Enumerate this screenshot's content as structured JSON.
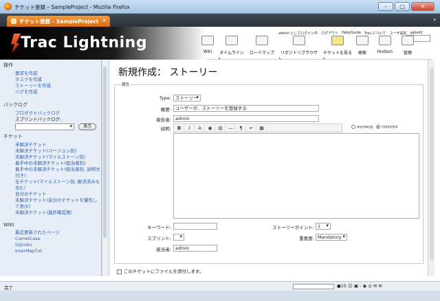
{
  "window": {
    "title": "チケット登録 – SampleProject - Mozilla Firefox",
    "buttons": [
      "–",
      "□",
      "✕"
    ]
  },
  "tab": {
    "label": "チケット登録 – SampleProject",
    "close": "×",
    "menu": "▾"
  },
  "banner": {
    "logo_text": "Trac Lightning",
    "metanav": [
      "admin としてログイン中",
      "ログアウト",
      "Help/Guide",
      "Trac について",
      "ユーザ設定",
      "agile42"
    ],
    "mainnav": [
      "Wiki",
      "タイムライン",
      "ロードマップ",
      "リポジトリブラウザ",
      "チケットを見る",
      "検索",
      "Hudson",
      "管理"
    ]
  },
  "sidebar": {
    "ops_heading": "操作",
    "ops_links": [
      "要求を作成",
      "タスクを作成",
      "ストーリーを作成",
      "バグを作成"
    ],
    "backlog_heading": "バックログ",
    "backlog_links": [
      "プロダクトバックログ"
    ],
    "sprint_backlog_label": "スプリントバックログ:",
    "show_button": "表示",
    "tickets_heading": "チケット",
    "ticket_links": [
      "未解決チケット",
      "未解決チケット(バージョン別)",
      "未解決チケット(マイルストーン別)",
      "着手中の未解決チケット(担当者別)",
      "着手中の未解決チケット(担当者別, 説明文付き)",
      "全チケット(マイルストーン別, 解決済みも含む)",
      "自分のチケット",
      "未解決チケット(自分のチケットを優先して表示)",
      "未解決チケット(進捗確認用)"
    ],
    "wiki_heading": "WIKI",
    "wiki_links": [
      "最近更新されたページ",
      "CamelCase",
      "Gijiroku",
      "InterMapTxt"
    ]
  },
  "form": {
    "page_title": "新規作成： ストーリー",
    "legend": "属性",
    "type_label": "Type:",
    "type_value": "ストーリー",
    "summary_label": "概要:",
    "summary_value": "ユーザーが、ストーリーを登録する",
    "reporter_label": "報告者:",
    "reporter_value": "admin",
    "description_label": "説明:",
    "toolbar": [
      "B",
      "I",
      "A",
      "◉",
      "▤",
      "—",
      "¶",
      "↵",
      "▦"
    ],
    "wysiwyg_label": "wysiwyg",
    "textarea_label": "textarea",
    "keyword_label": "キーワード:",
    "keyword_value": "",
    "story_points_label": "ストーリーポイント:",
    "story_points_value": "1",
    "sprint_label": "スプリント:",
    "sprint_value": "",
    "importance_label": "重要度:",
    "importance_value": "Mandatory",
    "owner_label": "担当者:",
    "owner_value": "admin",
    "attach_label": "このチケットにファイルを添付します。"
  },
  "statusbar": {
    "status": "完了",
    "tray": "●15 ☺ ▣ - ◉ ◎ ✉ ✉"
  }
}
